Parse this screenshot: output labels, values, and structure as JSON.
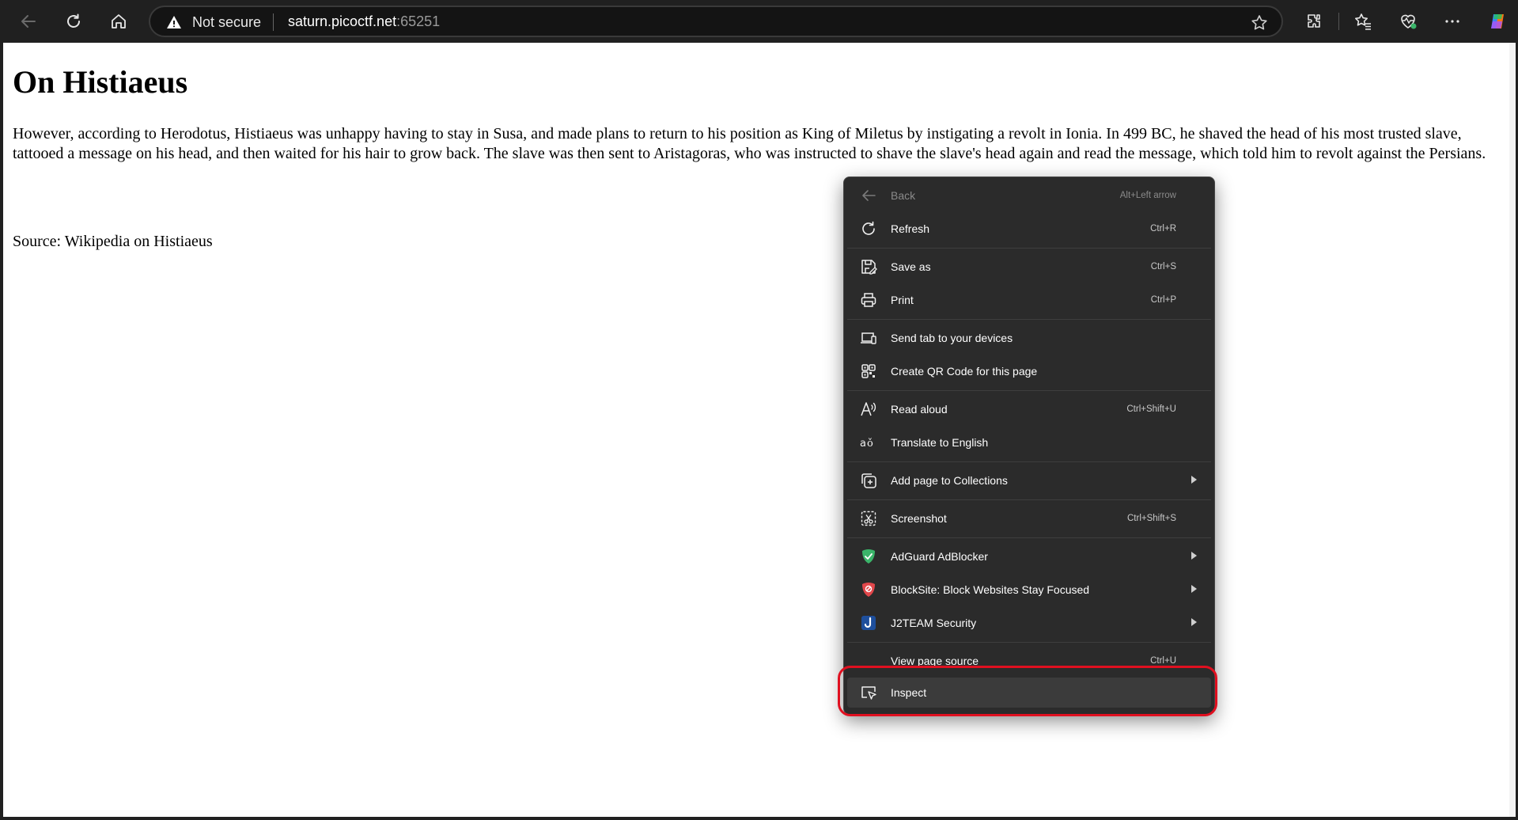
{
  "browser": {
    "security_label": "Not secure",
    "url_host": "saturn.picoctf.net",
    "url_port": ":65251"
  },
  "page": {
    "heading": "On Histiaeus",
    "paragraph": "However, according to Herodotus, Histiaeus was unhappy having to stay in Susa, and made plans to return to his position as King of Miletus by instigating a revolt in Ionia. In 499 BC, he shaved the head of his most trusted slave, tattooed a message on his head, and then waited for his hair to grow back. The slave was then sent to Aristagoras, who was instructed to shave the slave's head again and read the message, which told him to revolt against the Persians.",
    "source": "Source: Wikipedia on Histiaeus"
  },
  "context_menu": {
    "back": {
      "label": "Back",
      "shortcut": "Alt+Left arrow"
    },
    "refresh": {
      "label": "Refresh",
      "shortcut": "Ctrl+R"
    },
    "save_as": {
      "label": "Save as",
      "shortcut": "Ctrl+S"
    },
    "print": {
      "label": "Print",
      "shortcut": "Ctrl+P"
    },
    "send_tab": {
      "label": "Send tab to your devices"
    },
    "qr_code": {
      "label": "Create QR Code for this page"
    },
    "read_aloud": {
      "label": "Read aloud",
      "shortcut": "Ctrl+Shift+U"
    },
    "translate": {
      "label": "Translate to English"
    },
    "collections": {
      "label": "Add page to Collections"
    },
    "screenshot": {
      "label": "Screenshot",
      "shortcut": "Ctrl+Shift+S"
    },
    "adguard": {
      "label": "AdGuard AdBlocker"
    },
    "blocksite": {
      "label": "BlockSite: Block Websites  Stay Focused"
    },
    "j2team": {
      "label": "J2TEAM Security"
    },
    "view_source": {
      "label": "View page source",
      "shortcut": "Ctrl+U"
    },
    "inspect": {
      "label": "Inspect"
    }
  },
  "colors": {
    "highlight_box": "#e01020",
    "menu_background": "#2b2b2b",
    "adguard_green": "#3bb56a",
    "blocksite_red": "#e2474b",
    "j2team_blue": "#1e4f9c"
  }
}
